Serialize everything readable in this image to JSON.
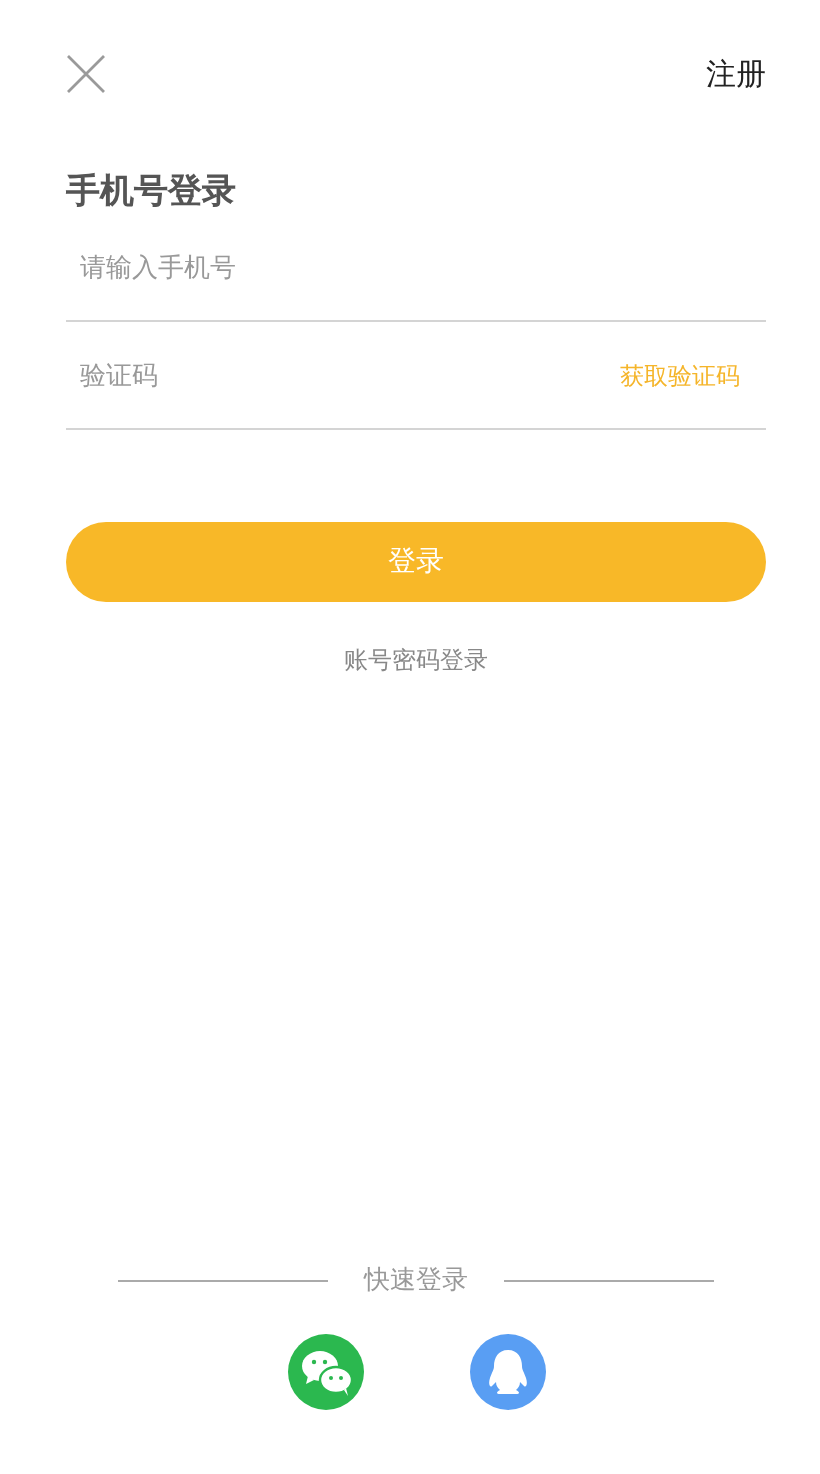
{
  "header": {
    "register": "注册"
  },
  "title": "手机号登录",
  "phone_field": {
    "placeholder": "请输入手机号"
  },
  "code_field": {
    "placeholder": "验证码",
    "action": "获取验证码"
  },
  "login_button": "登录",
  "alt_login": "账号密码登录",
  "quick_login": {
    "label": "快速登录",
    "options": [
      {
        "kind": "wechat"
      },
      {
        "kind": "qq"
      }
    ]
  }
}
